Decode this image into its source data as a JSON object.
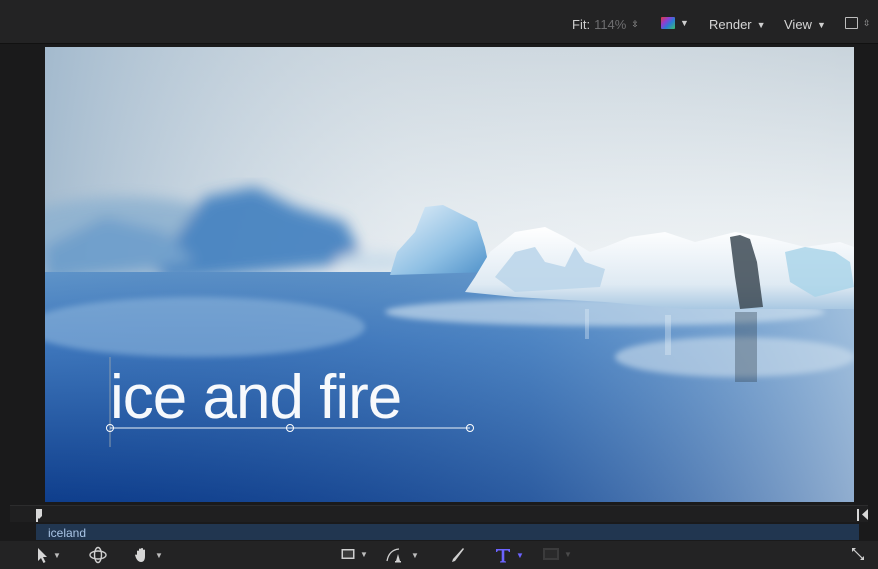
{
  "toolbar": {
    "fit_label": "Fit:",
    "fit_value": "114%",
    "render_label": "Render",
    "view_label": "View",
    "icons": [
      "color-channels-icon",
      "overlay-square-icon"
    ]
  },
  "canvas": {
    "title_text": "ice and fire"
  },
  "timeline": {
    "clip_label": "iceland",
    "track_color": "#213650"
  },
  "bottom_toolbar": {
    "tools": [
      "select-arrow-icon",
      "orbit-icon",
      "hand-pan-icon",
      "rectangle-shape-icon",
      "pen-bezier-icon",
      "paint-stroke-icon",
      "text-tool-icon",
      "mask-icon",
      "fullscreen-icon"
    ],
    "accent_color": "#6c63ff"
  }
}
